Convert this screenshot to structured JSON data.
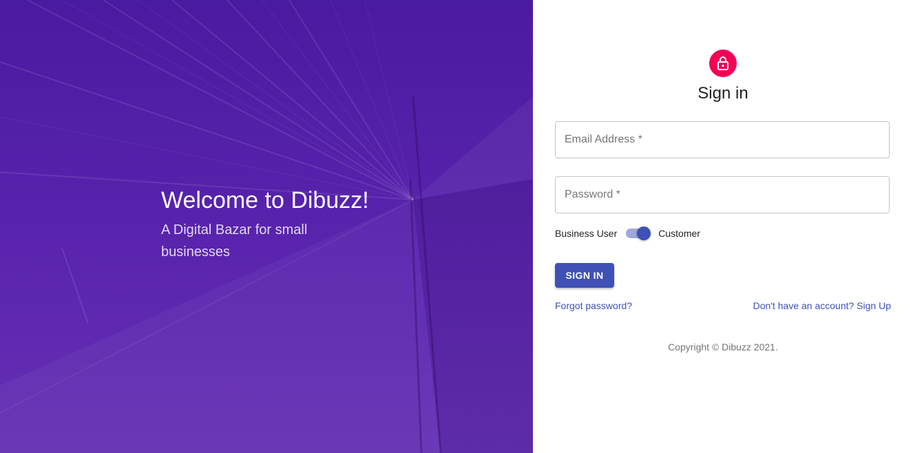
{
  "hero": {
    "title": "Welcome to Dibuzz!",
    "subtitle": "A Digital Bazar for small businesses"
  },
  "signin": {
    "avatar_icon": "lock-icon",
    "avatar_color": "#f50057",
    "title": "Sign in",
    "email_placeholder": "Email Address *",
    "email_value": "",
    "password_placeholder": "Password *",
    "password_value": "",
    "toggle": {
      "left_label": "Business User",
      "right_label": "Customer",
      "selected": "Customer"
    },
    "button_label": "SIGN IN",
    "forgot_link": "Forgot password?",
    "signup_link": "Don't have an account? Sign Up",
    "copyright": "Copyright © Dibuzz 2021."
  },
  "colors": {
    "primary": "#3f51b5",
    "hero_purple": "#5a24ae",
    "accent": "#f50057"
  }
}
